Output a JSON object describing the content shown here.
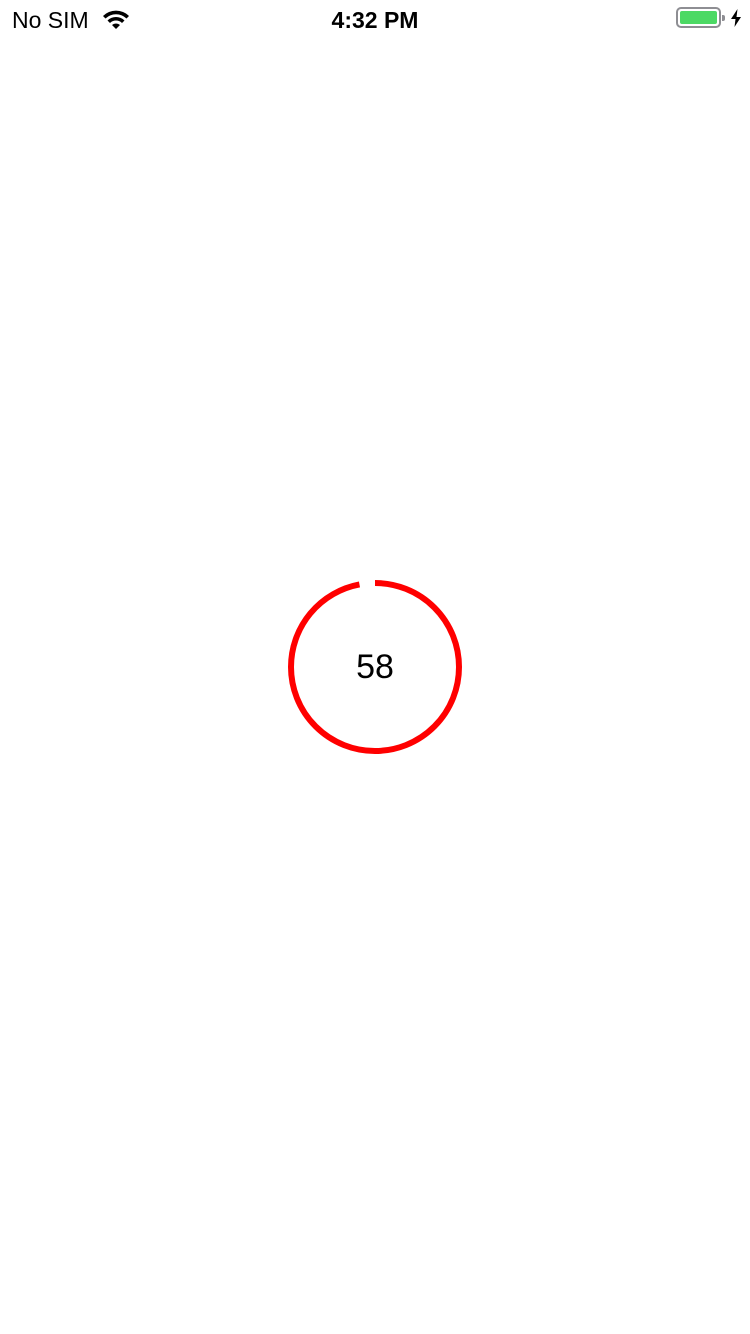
{
  "status_bar": {
    "carrier": "No SIM",
    "time": "4:32 PM",
    "battery_level": 1.0,
    "battery_color": "#4cd964",
    "charging": true,
    "icons": [
      "wifi-icon",
      "battery-icon",
      "charging-bolt-icon"
    ]
  },
  "progress": {
    "value": "58",
    "fraction": 0.97,
    "ring_color": "#ff0000"
  }
}
